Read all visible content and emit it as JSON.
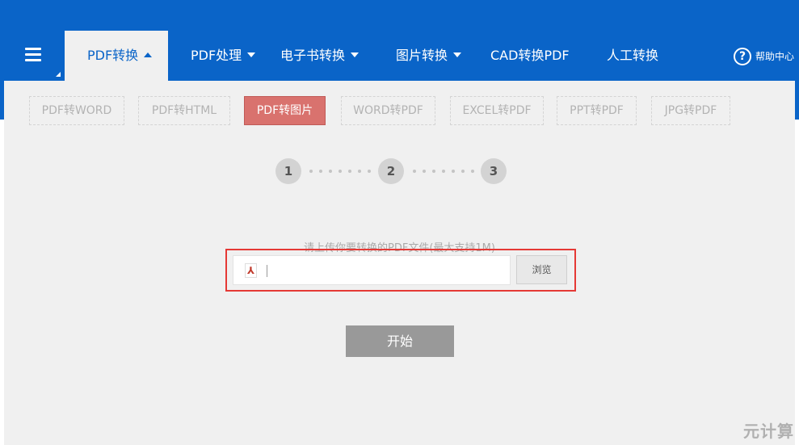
{
  "nav": {
    "items": [
      {
        "label": "PDF转换",
        "has_caret": true,
        "active": true
      },
      {
        "label": "PDF处理",
        "has_caret": true
      },
      {
        "label": "电子书转换",
        "has_caret": true
      },
      {
        "label": "图片转换",
        "has_caret": true
      },
      {
        "label": "CAD转换PDF",
        "has_caret": false
      },
      {
        "label": "人工转换",
        "has_caret": false
      }
    ],
    "help_label": "帮助中心",
    "help_icon_glyph": "?"
  },
  "subtabs": [
    {
      "label": "PDF转WORD"
    },
    {
      "label": "PDF转HTML"
    },
    {
      "label": "PDF转图片",
      "active": true
    },
    {
      "label": "WORD转PDF"
    },
    {
      "label": "EXCEL转PDF"
    },
    {
      "label": "PPT转PDF"
    },
    {
      "label": "JPG转PDF"
    }
  ],
  "steps": [
    "1",
    "2",
    "3"
  ],
  "upload": {
    "hint": "请上传你要转换的PDF文件(最大支持1M)",
    "value": "",
    "browse_label": "浏览"
  },
  "start_label": "开始",
  "watermark": "元计算",
  "colors": {
    "header_blue": "#0a64c8",
    "active_subtab": "#d9726e",
    "highlight_frame": "#e53935",
    "start_button": "#999999"
  }
}
